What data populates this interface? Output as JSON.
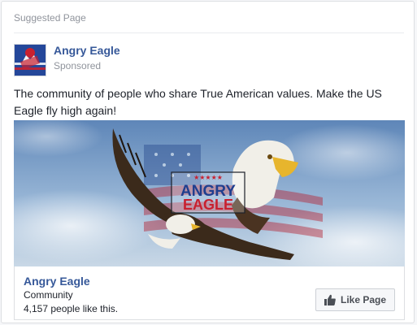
{
  "colors": {
    "link": "#365899",
    "muted": "#90949c",
    "text": "#1d2129",
    "border": "#dddfe2"
  },
  "header": {
    "title": "Suggested Page"
  },
  "page": {
    "name": "Angry Eagle",
    "sponsored_label": "Sponsored",
    "avatar_icon": "flag-eagle-logo"
  },
  "post": {
    "text": "The community of people who share True American values. Make the US Eagle fly high again!"
  },
  "hero": {
    "description_icon": "eagle-flag-banner",
    "logo_line1": "ANGRY",
    "logo_line2": "EAGLE",
    "stars": "★★★★★"
  },
  "footer": {
    "name": "Angry Eagle",
    "category": "Community",
    "likes": "4,157 people like this.",
    "like_button_label": "Like Page",
    "like_icon": "thumbs-up-icon"
  }
}
